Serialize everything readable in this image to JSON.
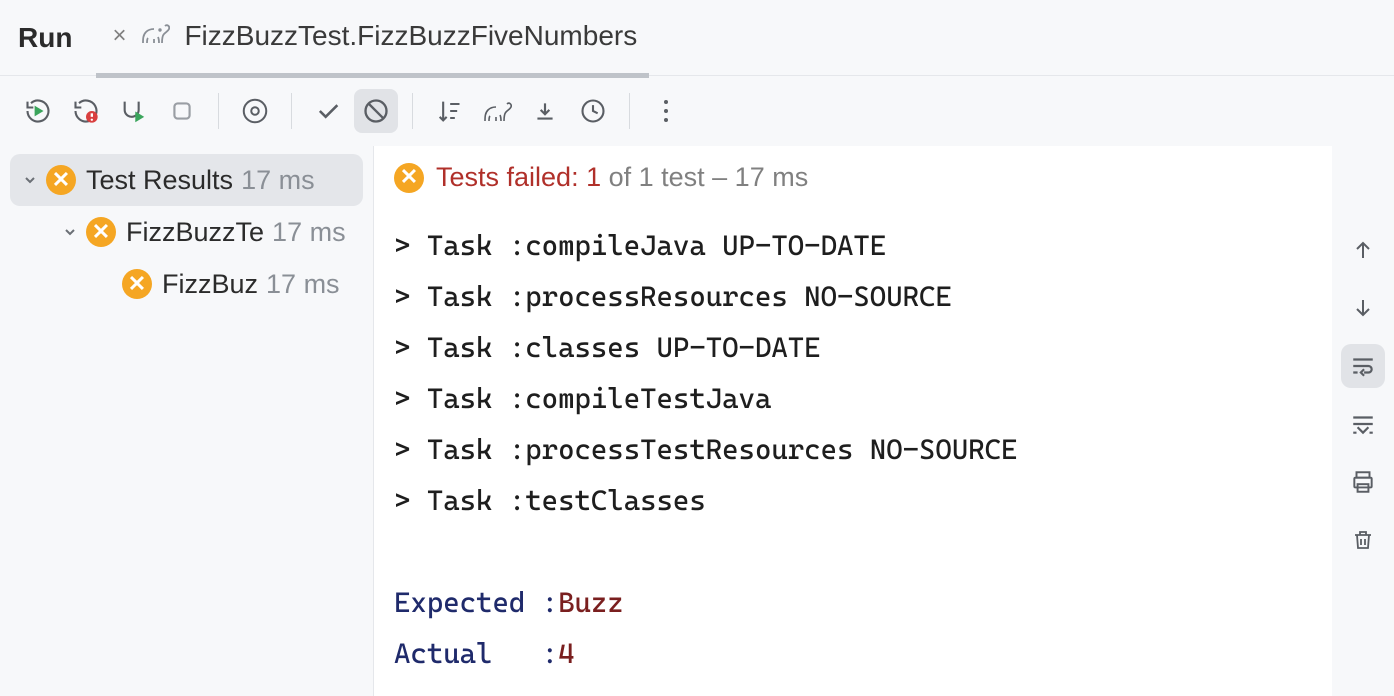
{
  "header": {
    "run_label": "Run",
    "tab_title": "FizzBuzzTest.FizzBuzzFiveNumbers"
  },
  "tree": {
    "root": {
      "label": "Test Results",
      "time": "17 ms"
    },
    "class_node": {
      "label": "FizzBuzzTe",
      "time": "17 ms"
    },
    "method_node": {
      "label": "FizzBuz",
      "time": "17 ms"
    }
  },
  "status": {
    "prefix": "Tests failed: ",
    "fail_count": "1",
    "suffix": " of 1 test – 17 ms"
  },
  "console_lines": [
    "> Task :compileJava UP-TO-DATE",
    "> Task :processResources NO-SOURCE",
    "> Task :classes UP-TO-DATE",
    "> Task :compileTestJava",
    "> Task :processTestResources NO-SOURCE",
    "> Task :testClasses"
  ],
  "diff": {
    "expected_label": "Expected :",
    "expected_value": "Buzz",
    "actual_label": "Actual   :",
    "actual_value": "4"
  }
}
